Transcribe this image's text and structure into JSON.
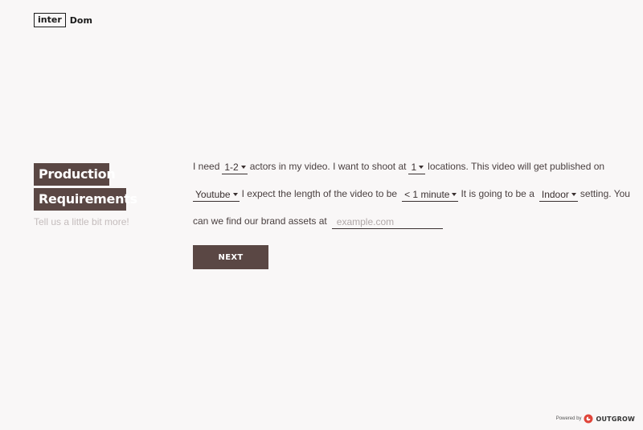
{
  "logo": {
    "boxed": "inter",
    "rest": "Dom"
  },
  "heading": {
    "line1": "Production",
    "line2": "Requirements",
    "subtitle": "Tell us a little bit more!"
  },
  "form": {
    "row1": {
      "t1": "I need",
      "actors_value": "1-2",
      "t2": "actors in my video.  I want to shoot at",
      "locations_value": "1",
      "t3": "locations.  This video will get published on"
    },
    "row2": {
      "platform_value": "Youtube",
      "t1": "I expect the length of the video to be",
      "length_value": "< 1 minute",
      "t2": "It is going to be a",
      "setting_value": "Indoor",
      "t3": "setting.  You"
    },
    "row3": {
      "t1": "can we find our brand assets at",
      "brand_placeholder": "example.com",
      "brand_value": ""
    }
  },
  "next_button": "NEXT",
  "powered": {
    "prefix": "Powered by",
    "brand": "OUTGROW",
    "icon": "outgrow-logo-icon"
  },
  "colors": {
    "accent": "#5a4744",
    "background": "#f9f7f7",
    "text": "#4a4040",
    "muted": "#c4bcbc"
  }
}
